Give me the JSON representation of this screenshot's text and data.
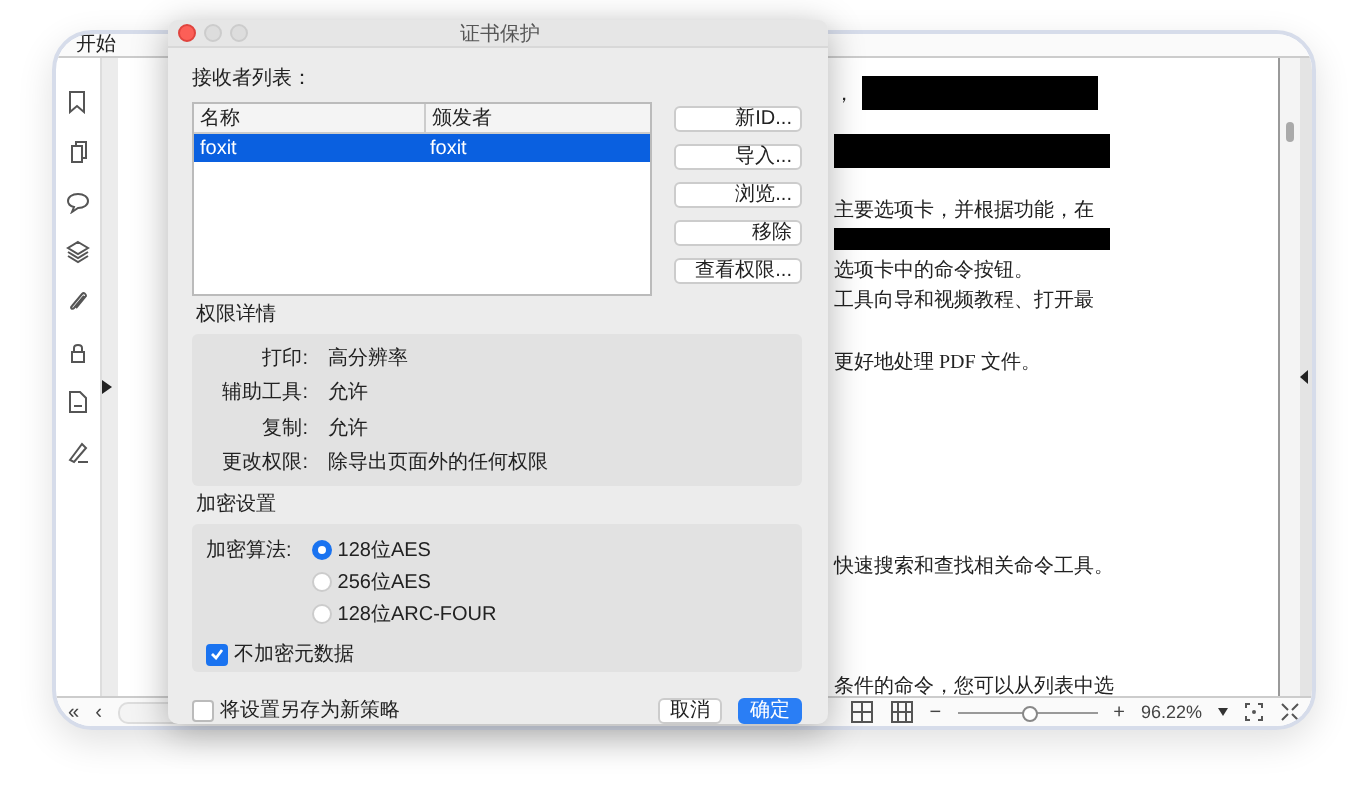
{
  "app": {
    "tab": "开始",
    "first_page": "«",
    "previous_page": "‹",
    "zoom_out": "−",
    "zoom_in": "+",
    "zoom": "96.22%",
    "zoom_slider": {
      "level": 0.5
    }
  },
  "document": {
    "lines": [
      {
        "text": "，",
        "redacted": true
      },
      {
        "redacted": true
      },
      {
        "text": "主要选项卡，并根据功能，在",
        "redacted": false
      },
      {
        "redacted": true
      },
      {
        "text": "选项卡中的命令按钮。",
        "redacted": false
      },
      {
        "text": "工具向导和视频教程、打开最",
        "redacted": false
      },
      {
        "text": "更好地处理 PDF 文件。",
        "redacted": false
      },
      {
        "text": "快速搜索和查找相关命令工具。",
        "redacted": false
      },
      {
        "text": "条件的命令，您可以从列表中选",
        "redacted": false
      }
    ]
  },
  "dialog": {
    "title": "证书保护",
    "recipients_label": "接收者列表：",
    "table": {
      "columns": [
        "名称",
        "颁发者"
      ],
      "rows": [
        {
          "cells": [
            "foxit",
            "foxit"
          ],
          "selected": true
        }
      ]
    },
    "buttons": [
      "新ID...",
      "导入...",
      "浏览...",
      "移除",
      "查看权限..."
    ],
    "permissions_label": "权限详情",
    "permissions": [
      {
        "label": "打印:",
        "value": "高分辨率"
      },
      {
        "label": "辅助工具:",
        "value": "允许"
      },
      {
        "label": "复制:",
        "value": "允许"
      },
      {
        "label": "更改权限:",
        "value": "除导出页面外的任何权限"
      }
    ],
    "encryption_label": "加密设置",
    "algorithm_label": "加密算法:",
    "algorithms": [
      {
        "label": "128位AES",
        "selected": true
      },
      {
        "label": "256位AES",
        "selected": false
      },
      {
        "label": "128位ARC-FOUR",
        "selected": false
      }
    ],
    "metadata": {
      "label": "不加密元数据",
      "checked": true
    },
    "save_policy": {
      "label": "将设置另存为新策略",
      "checked": false
    },
    "footer_buttons": [
      {
        "label": "取消",
        "kind": "secondary"
      },
      {
        "label": "确定",
        "kind": "primary"
      }
    ]
  }
}
